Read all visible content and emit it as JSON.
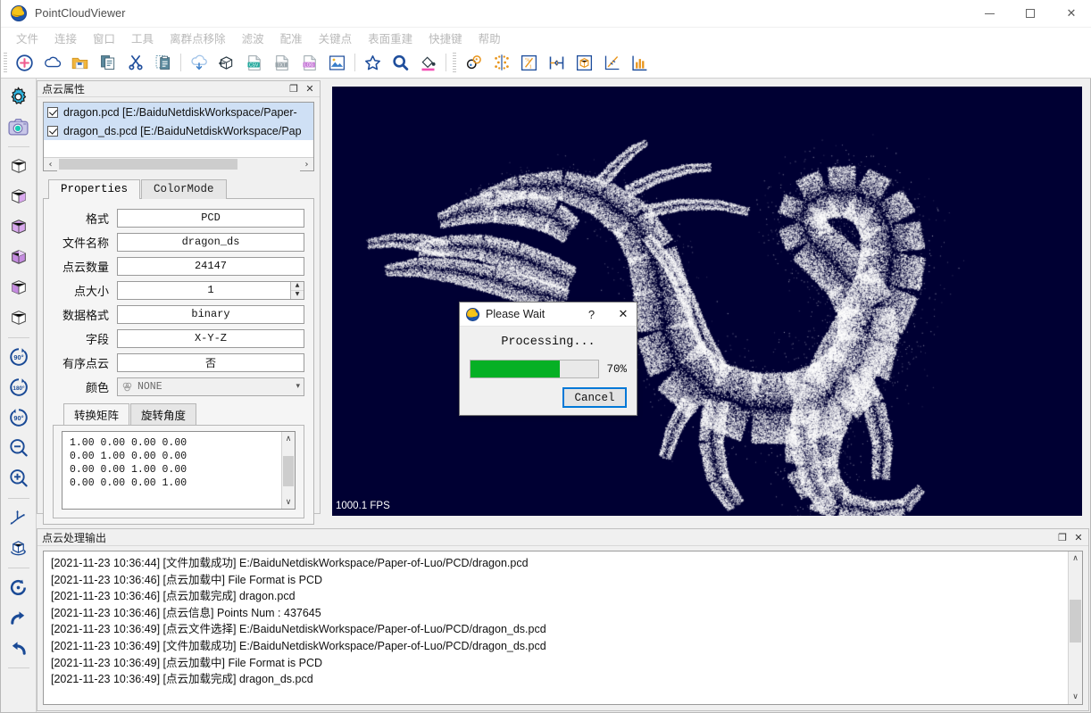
{
  "window": {
    "title": "PointCloudViewer",
    "logo_icon": "app-logo-icon",
    "minimize_label": "—",
    "maximize_label": "□",
    "close_label": "✕"
  },
  "menubar": {
    "items": [
      {
        "label": "文件"
      },
      {
        "label": "连接"
      },
      {
        "label": "窗口"
      },
      {
        "label": "工具"
      },
      {
        "label": "离群点移除"
      },
      {
        "label": "滤波"
      },
      {
        "label": "配准"
      },
      {
        "label": "关键点"
      },
      {
        "label": "表面重建"
      },
      {
        "label": "快捷键"
      },
      {
        "label": "帮助"
      }
    ]
  },
  "toolbar": {
    "groups": [
      {
        "icons": [
          "add-point-cloud-icon",
          "cloud-icon",
          "open-folder-icon",
          "copy-document-icon",
          "cut-scissors-icon",
          "paste-clipboard-icon"
        ]
      },
      {
        "icons": [
          "cloud-download-icon",
          "export-cube-icon",
          "save-csv-icon",
          "save-txt-icon",
          "save-log-icon",
          "save-image-icon"
        ]
      },
      {
        "icons": [
          "favorite-star-icon",
          "search-magnifier-icon",
          "fill-color-icon"
        ]
      },
      {
        "icons": [
          "registration-pair-icon",
          "mirror-points-icon",
          "normalize-icon",
          "align-center-icon",
          "bounding-box-icon",
          "axis-plot-icon",
          "histogram-icon"
        ]
      }
    ]
  },
  "rail": {
    "groups": [
      {
        "icons": [
          "settings-gear-icon",
          "camera-capture-icon"
        ]
      },
      {
        "icons": [
          "view-iso-icon",
          "view-front-icon",
          "view-top-icon",
          "view-right-icon",
          "view-left-icon",
          "view-back-icon"
        ]
      },
      {
        "icons": [
          "rotate-90-cw-icon",
          "rotate-180-icon",
          "rotate-90-ccw-icon",
          "zoom-out-icon",
          "zoom-in-icon"
        ]
      },
      {
        "icons": [
          "coordinate-axes-icon",
          "orbit-cube-icon"
        ]
      },
      {
        "icons": [
          "reset-view-icon",
          "redo-icon",
          "undo-icon"
        ]
      }
    ]
  },
  "properties_dock": {
    "title": "点云属性",
    "float_label": "❐",
    "close_label": "✕",
    "file_list": [
      {
        "name": "dragon.pcd [E:/BaiduNetdiskWorkspace/Paper-",
        "checked": true
      },
      {
        "name": "dragon_ds.pcd [E:/BaiduNetdiskWorkspace/Pap",
        "checked": true
      }
    ],
    "hscroll": {
      "left_arrow": "‹",
      "right_arrow": "›"
    },
    "tabs": [
      {
        "label": "Properties",
        "active": true
      },
      {
        "label": "ColorMode",
        "active": false
      }
    ],
    "fields": [
      {
        "label": "格式",
        "value": "PCD",
        "type": "text"
      },
      {
        "label": "文件名称",
        "value": "dragon_ds",
        "type": "text"
      },
      {
        "label": "点云数量",
        "value": "24147",
        "type": "text"
      },
      {
        "label": "点大小",
        "value": "1",
        "type": "spinner"
      },
      {
        "label": "数据格式",
        "value": "binary",
        "type": "text"
      },
      {
        "label": "字段",
        "value": "X-Y-Z",
        "type": "text"
      },
      {
        "label": "有序点云",
        "value": "否",
        "type": "text"
      },
      {
        "label": "颜色",
        "value": "NONE",
        "type": "combo"
      }
    ],
    "matrix_tabs": [
      {
        "label": "转换矩阵",
        "active": true
      },
      {
        "label": "旋转角度",
        "active": false
      }
    ],
    "matrix_text": "1.00 0.00 0.00 0.00\n0.00 1.00 0.00 0.00\n0.00 0.00 1.00 0.00\n0.00 0.00 0.00 1.00",
    "scroll_up": "∧",
    "scroll_down": "∨"
  },
  "viewport": {
    "fps": "1000.1 FPS",
    "background_color": "#000033",
    "point_color": "#ffffff",
    "model": "dragon point cloud"
  },
  "dialog": {
    "title": "Please Wait",
    "logo_icon": "app-logo-icon",
    "help_label": "?",
    "close_label": "✕",
    "message": "Processing...",
    "progress_percent": 70,
    "progress_label": "70%",
    "progress_color": "#06b025",
    "cancel_label": "Cancel"
  },
  "output_dock": {
    "title": "点云处理输出",
    "float_label": "❐",
    "close_label": "✕",
    "scroll_up": "∧",
    "scroll_down": "∨",
    "lines": [
      "[2021-11-23 10:36:44] [文件加载成功] E:/BaiduNetdiskWorkspace/Paper-of-Luo/PCD/dragon.pcd",
      "[2021-11-23 10:36:46] [点云加载中] File Format is PCD",
      "[2021-11-23 10:36:46] [点云加载完成] dragon.pcd",
      "[2021-11-23 10:36:46] [点云信息] Points Num : 437645",
      "[2021-11-23 10:36:49] [点云文件选择] E:/BaiduNetdiskWorkspace/Paper-of-Luo/PCD/dragon_ds.pcd",
      "[2021-11-23 10:36:49] [文件加载成功] E:/BaiduNetdiskWorkspace/Paper-of-Luo/PCD/dragon_ds.pcd",
      "[2021-11-23 10:36:49] [点云加载中] File Format is PCD",
      "[2021-11-23 10:36:49] [点云加载完成] dragon_ds.pcd"
    ]
  }
}
